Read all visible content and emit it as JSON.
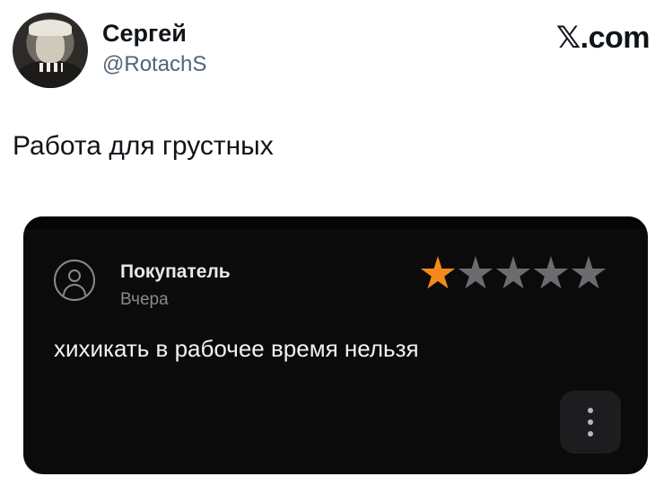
{
  "tweet": {
    "author_name": "Сергей",
    "author_handle": "@RotachS",
    "brand": "𝕏.com",
    "text": "Работа для грустных"
  },
  "review_card": {
    "reviewer": "Покупатель",
    "date": "Вчера",
    "rating": 1,
    "max_rating": 5,
    "review_text": "хихикать в рабочее время нельзя",
    "colors": {
      "star_filled": "#f28a1a",
      "star_empty": "#6b6b70",
      "background": "#0b0b0c"
    }
  }
}
